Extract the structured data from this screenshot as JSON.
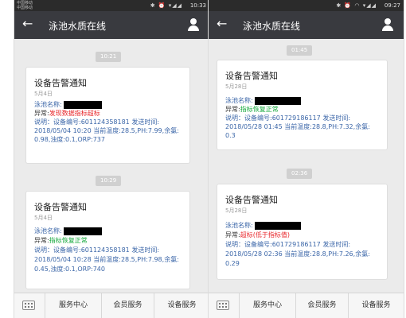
{
  "phones": [
    {
      "statusbar": {
        "carrier1": "中国移动",
        "carrier2": "中国移动",
        "icons": "✱ ⏰ ▾◢◢",
        "time": "10:33"
      },
      "header": {
        "back": "←",
        "title": "泳池水质在线"
      },
      "messages": [
        {
          "time": "10:21",
          "title": "设备告警通知",
          "date": "5月4日",
          "name_label": "泳池名称:",
          "abn_label": "异常:",
          "abn_value": "发现数据指标超标",
          "desc_line1": "说明：设备编号:601124358181 发送时间:",
          "desc_line2": "2018/05/04 10:20 当前温度:28.5,PH:7.99,余氯:",
          "desc_line3": "0.98,浊度:0.1,ORP:737"
        },
        {
          "time": "10:29",
          "title": "设备告警通知",
          "date": "5月4日",
          "name_label": "泳池名称:",
          "abn_label": "异常:",
          "abn_value": "指标恢复正常",
          "desc_line1": "说明：设备编号:601124358181 发送时间:",
          "desc_line2": "2018/05/04 10:28 当前温度:28.5,PH:7.98,余氯:",
          "desc_line3": "0.45,浊度:0.1,ORP:740"
        }
      ],
      "menu": [
        "服务中心",
        "会员服务",
        "设备服务"
      ]
    },
    {
      "statusbar": {
        "carrier1": "",
        "carrier2": "",
        "icons": "✱ ⏰ ◠ ▾◢◢",
        "time": "09:27"
      },
      "header": {
        "back": "←",
        "title": "泳池水质在线"
      },
      "messages": [
        {
          "time": "01:45",
          "title": "设备告警通知",
          "date": "5月28日",
          "name_label": "泳池名称:",
          "abn_label": "异常:",
          "abn_value": "指标恢复正常",
          "desc_line1": "说明：设备编号:601729186117 发送时间:",
          "desc_line2": "2018/05/28 01:45 当前温度:28.8,PH:7.32,余氯:",
          "desc_line3": "0.3"
        },
        {
          "time": "02:36",
          "title": "设备告警通知",
          "date": "5月28日",
          "name_label": "泳池名称:",
          "abn_label": "异常:",
          "abn_value": "超标(低于指标值)",
          "desc_line1": "说明：设备编号:601729186117 发送时间:",
          "desc_line2": "2018/05/28 02:36 当前温度:28.8,PH:7.26,余氯:",
          "desc_line3": "0.29"
        }
      ],
      "menu": [
        "服务中心",
        "会员服务",
        "设备服务"
      ]
    }
  ],
  "colors": {
    "titlebar": "#393a3f",
    "statusbar": "#2b2b2b",
    "chat_bg": "#ebebeb",
    "alert_red": "#e8262a",
    "ok_green": "#14a83b",
    "label_blue": "#3b66a8"
  }
}
